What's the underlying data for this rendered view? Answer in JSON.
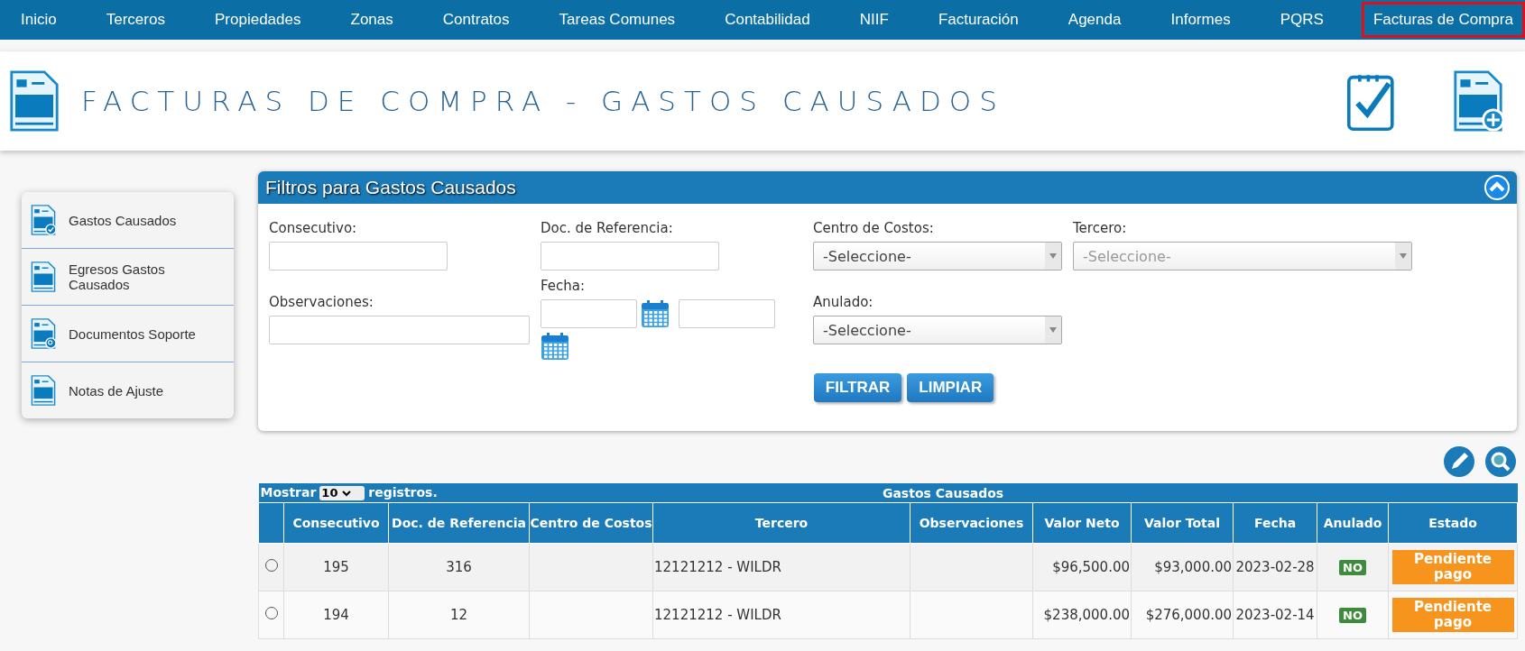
{
  "nav": [
    {
      "label": "Inicio",
      "selected": false
    },
    {
      "label": "Terceros",
      "selected": false
    },
    {
      "label": "Propiedades",
      "selected": false
    },
    {
      "label": "Zonas",
      "selected": false
    },
    {
      "label": "Contratos",
      "selected": false
    },
    {
      "label": "Tareas Comunes",
      "selected": false
    },
    {
      "label": "Contabilidad",
      "selected": false
    },
    {
      "label": "NIIF",
      "selected": false
    },
    {
      "label": "Facturación",
      "selected": false
    },
    {
      "label": "Agenda",
      "selected": false
    },
    {
      "label": "Informes",
      "selected": false
    },
    {
      "label": "PQRS",
      "selected": false
    },
    {
      "label": "Facturas de Compra",
      "selected": true
    }
  ],
  "header": {
    "title": "FACTURAS DE COMPRA - GASTOS CAUSADOS"
  },
  "sidebar": {
    "items": [
      {
        "label": "Gastos Causados",
        "kind": "check"
      },
      {
        "label": "Egresos Gastos Causados",
        "kind": "doc"
      },
      {
        "label": "Documentos Soporte",
        "kind": "search"
      },
      {
        "label": "Notas de Ajuste",
        "kind": "doc"
      }
    ]
  },
  "filters": {
    "title": "Filtros para Gastos Causados",
    "fields": [
      {
        "kind": "text",
        "label": "Consecutivo:"
      },
      {
        "kind": "text",
        "label": "Doc. de Referencia:"
      },
      {
        "kind": "select",
        "label": "Centro de Costos:",
        "value": "-Seleccione-"
      },
      {
        "kind": "select",
        "label": "Tercero:",
        "placeholder": "-Seleccione-"
      },
      {
        "kind": "text",
        "label": "Observaciones:"
      },
      {
        "kind": "date",
        "label": "Fecha:"
      },
      {
        "kind": "select",
        "label": "Anulado:",
        "value": "-Seleccione-"
      }
    ],
    "buttons": [
      "FILTRAR",
      "LIMPIAR"
    ]
  },
  "table": {
    "show_label": "Mostrar",
    "page_size": "10",
    "records_label": "registros.",
    "title": "Gastos Causados",
    "columns": [
      "Consecutivo",
      "Doc. de Referencia",
      "Centro de Costos",
      "Tercero",
      "Observaciones",
      "Valor Neto",
      "Valor Total",
      "Fecha",
      "Anulado",
      "Estado"
    ],
    "rows": [
      {
        "selected": false,
        "consecutivo": "195",
        "doc": "316",
        "centro": "",
        "tercero": "12121212 - WILDR",
        "observaciones": "",
        "valor_neto": "$96,500.00",
        "valor_total": "$93,000.00",
        "fecha": "2023-02-28",
        "anulado": "NO",
        "estado": "Pendiente pago"
      },
      {
        "selected": false,
        "consecutivo": "194",
        "doc": "12",
        "centro": "",
        "tercero": "12121212 - WILDR",
        "observaciones": "",
        "valor_neto": "$238,000.00",
        "valor_total": "$276,000.00",
        "fecha": "2023-02-14",
        "anulado": "NO",
        "estado": "Pendiente pago"
      }
    ]
  }
}
